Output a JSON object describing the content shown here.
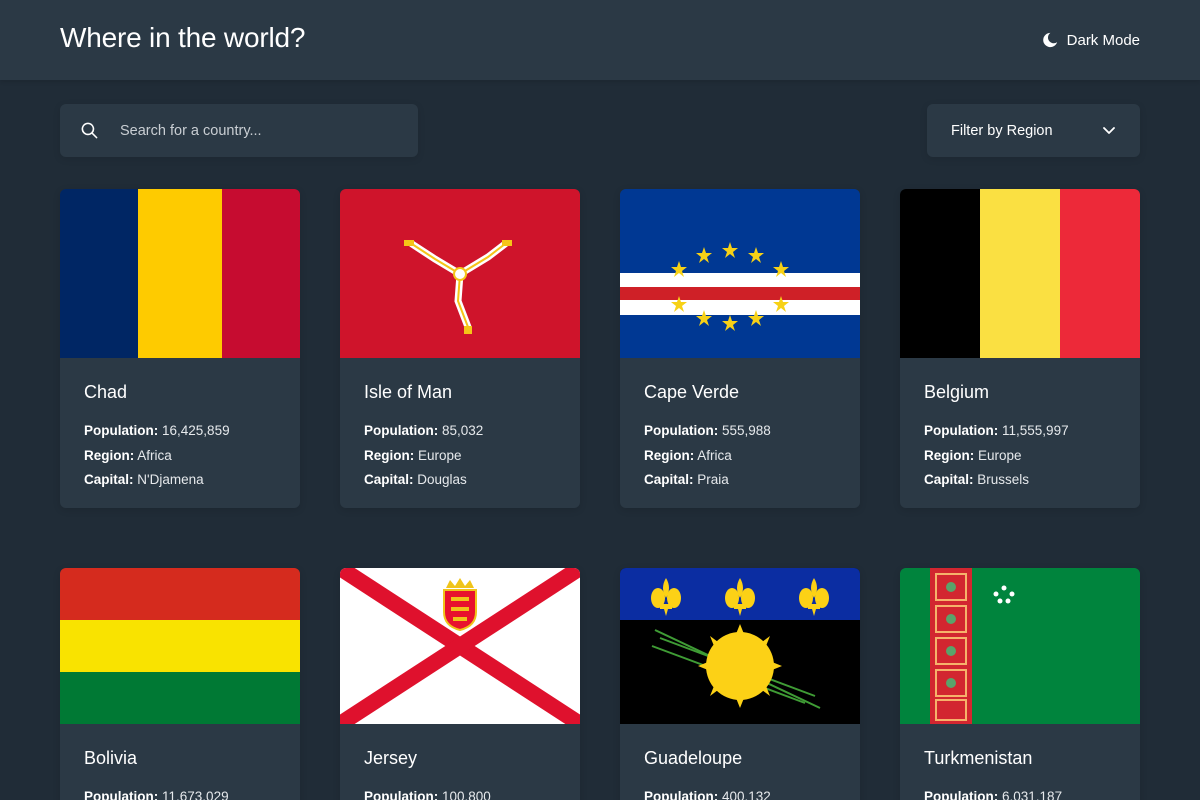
{
  "header": {
    "title": "Where in the world?",
    "theme_toggle_label": "Dark Mode",
    "theme_icon": "moon-icon"
  },
  "search": {
    "placeholder": "Search for a country...",
    "value": "",
    "icon": "search-icon"
  },
  "filter": {
    "label": "Filter by Region",
    "icon": "chevron-down-icon"
  },
  "field_labels": {
    "population": "Population:",
    "region": "Region:",
    "capital": "Capital:"
  },
  "countries": [
    {
      "name": "Chad",
      "population": "16,425,859",
      "region": "Africa",
      "capital": "N'Djamena"
    },
    {
      "name": "Isle of Man",
      "population": "85,032",
      "region": "Europe",
      "capital": "Douglas"
    },
    {
      "name": "Cape Verde",
      "population": "555,988",
      "region": "Africa",
      "capital": "Praia"
    },
    {
      "name": "Belgium",
      "population": "11,555,997",
      "region": "Europe",
      "capital": "Brussels"
    },
    {
      "name": "Bolivia",
      "population": "11,673,029"
    },
    {
      "name": "Jersey",
      "population": "100,800"
    },
    {
      "name": "Guadeloupe",
      "population": "400,132"
    },
    {
      "name": "Turkmenistan",
      "population": "6,031,187"
    }
  ],
  "colors": {
    "background": "#202c37",
    "elements": "#2b3945",
    "text": "#ffffff"
  }
}
